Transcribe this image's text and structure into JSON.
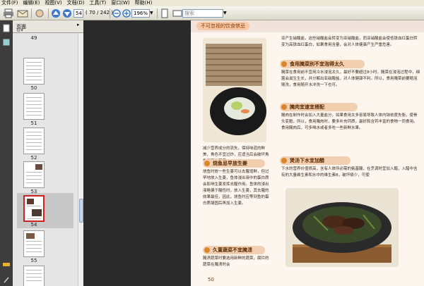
{
  "menu": [
    "文件(F)",
    "编辑(E)",
    "视图(V)",
    "文档(D)",
    "工具(T)",
    "窗口(W)",
    "帮助(H)"
  ],
  "toolbar": {
    "page_current": "54",
    "page_total": "( 70 / 242 )",
    "zoom": "196%",
    "search_placeholder": "搜索"
  },
  "panel": {
    "title": "页面"
  },
  "thumbnails": [
    {
      "label": "49"
    },
    {
      "label": "50"
    },
    {
      "label": "51"
    },
    {
      "label": "52"
    },
    {
      "label": "53"
    },
    {
      "label": "54"
    },
    {
      "label": "55"
    }
  ],
  "doc": {
    "header": "不可忽视的饮食禁忌",
    "para_top": "亚产生硝酸盐，这些硝酸盐会转变为亚硝酸盐，而亚硝酸盐会使低铁血红蛋白转变为高铁血红蛋白，如果食用含量，会对人体健康产生严重危害。",
    "s1_title": "食用腌菜别不宜泡得太久",
    "s1_text": "腌菜在食用前不宜用冷水浸泡太久，最好不要超过8小时。腌菜在浸泡过程中，细菌会滋生生长，并分解出亚硝酸盐，对人体健康不利。所以，食用腌菜前要随泡随洗，食用随开水冲洗一下也可。",
    "s2_title": "腌肉宜速宜搭配",
    "s2_text": "腌肉在制作时会加入大量盐分，如果食用太多容易导致人体内钠依度失衡，使骨头变脆，所以，食用腌肉时，要多补充钙质，最好和含钙丰富的食物一同食用。食用腌肉后，可多喝水或者多吃一些新鲜水果。",
    "s3_title": "烧鱼忌早放生姜",
    "s3_text": "烧鱼时放一些生姜可以去腥增鲜，但过早地放入生姜，鱼体浸出液中的蛋白质会影响生姜发挥去腥作用。鱼体的浸出液略偏于酸性时，放入生姜，其去腥的效果最佳，因此，烧鱼时应等到鱼的蛋白质凝固后再加入生姜。",
    "left_text": "减少营养成分的流失，保持味道的鲜美，角色不宜过炸，应适当后会破坏角色原有的营养。",
    "s4_title": "煲汤下水宜加醋",
    "s4_text": "下水的营养价值很高，含有人体所必需的氨基酸，在烹调时宜加入醋，入醋中含有的大量维生素和水中的维生素B，破坏极少，可使",
    "s5_title": "久置蔬菜不宜腌渍",
    "s5_text": "腌渍蔬菜时要选用新鲜的蔬菜，腐烂的蔬菜在腌渍时会",
    "page_number": "50"
  },
  "colors": {
    "accent": "#d9862a",
    "pill": "#f2cfb0",
    "page_bg": "#fdf6ee",
    "doc_bg": "#2a2a2a"
  }
}
